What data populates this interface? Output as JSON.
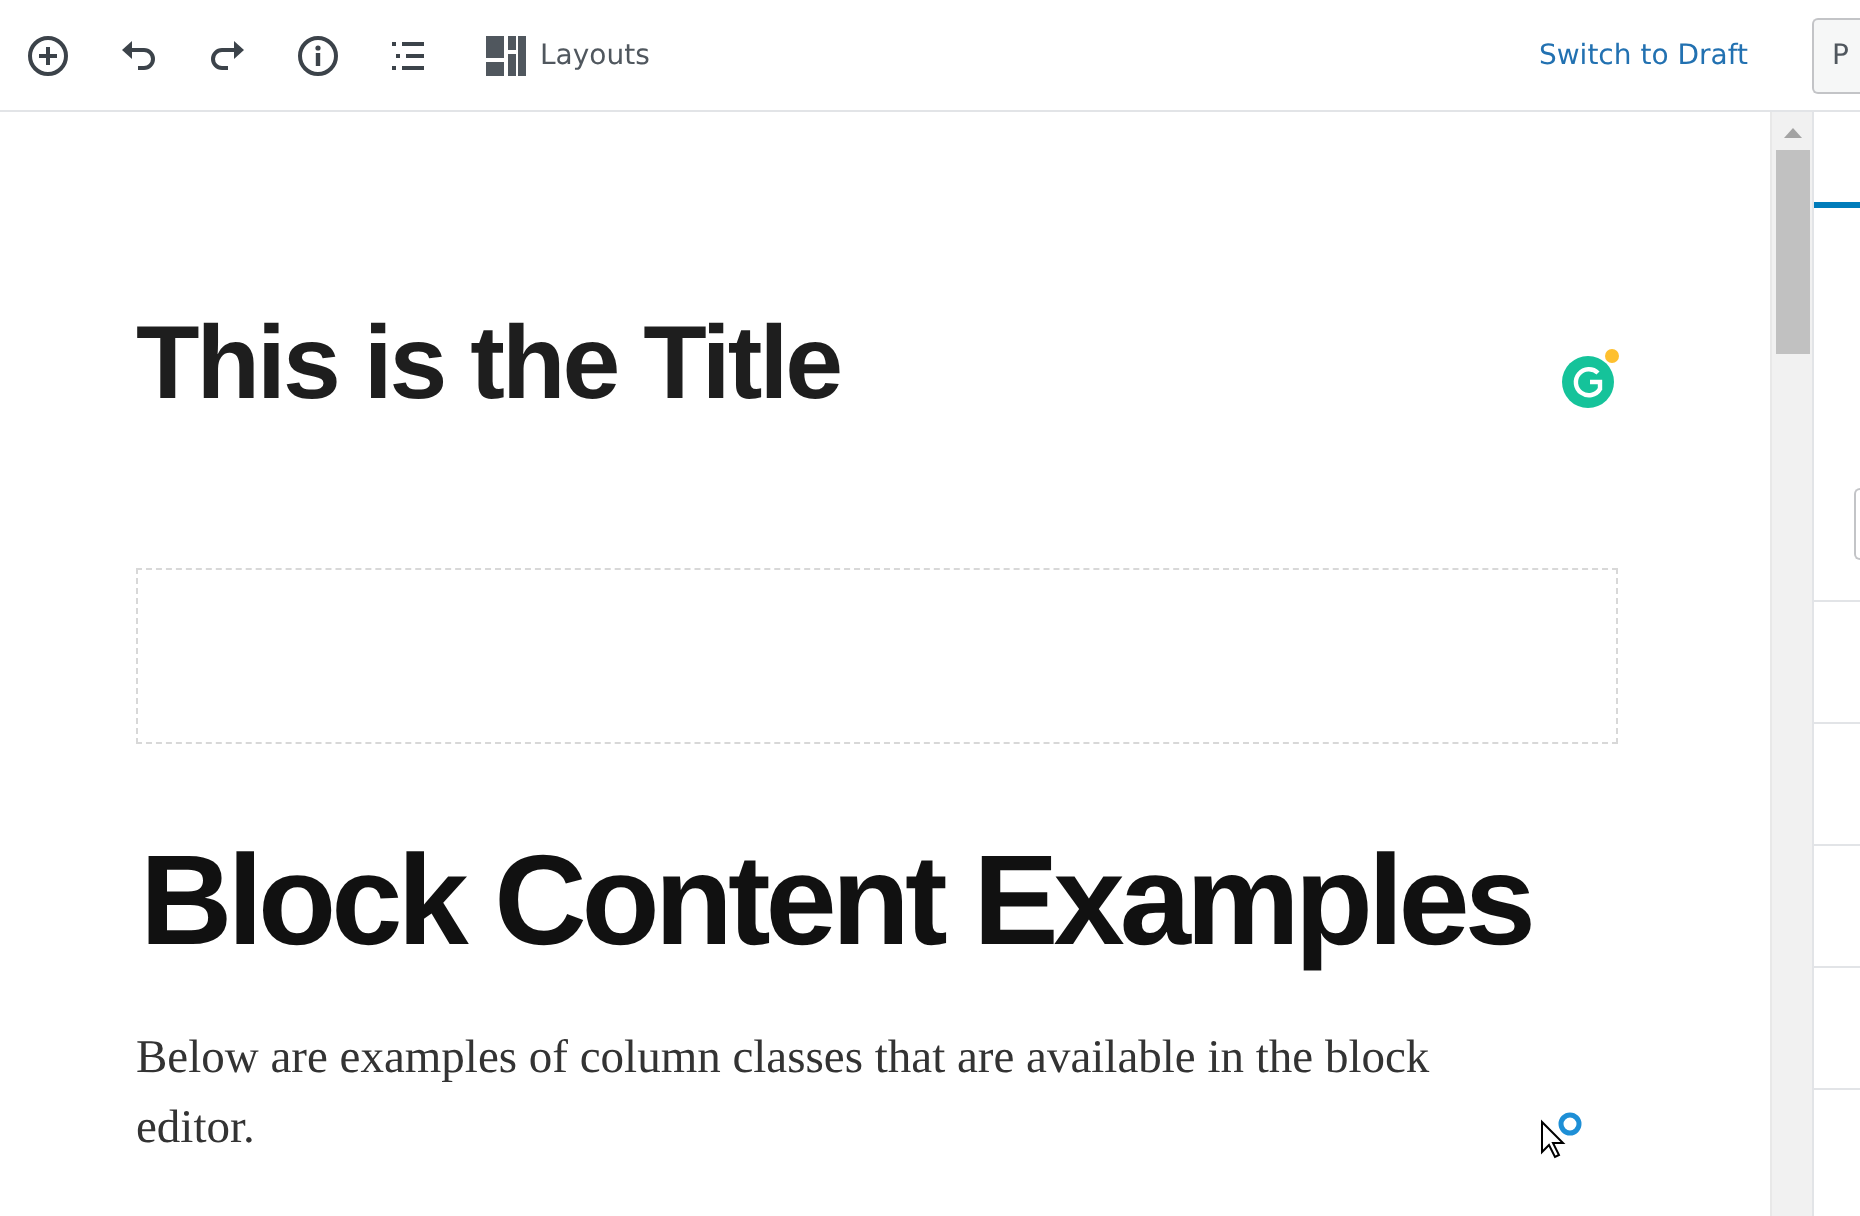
{
  "toolbar": {
    "layouts_label": "Layouts",
    "switch_label": "Switch to Draft",
    "publish_label": "P"
  },
  "editor": {
    "title": "This is the Title",
    "heading": "Block Content Examples",
    "paragraph": "Below are examples of column classes that are available in the block editor."
  },
  "sidebar": {
    "tabs": [
      {
        "selected": true
      }
    ]
  }
}
